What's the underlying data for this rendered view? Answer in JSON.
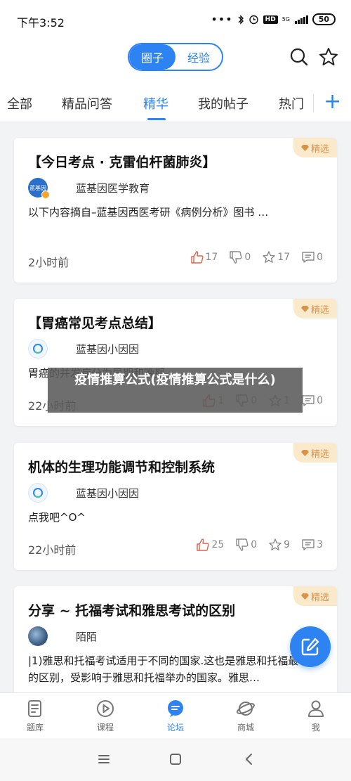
{
  "status_bar": {
    "time": "下午3:52",
    "dots": "•••",
    "hd": "HD",
    "net": "5G",
    "battery": "50"
  },
  "header": {
    "segments": [
      "圈子",
      "经验"
    ],
    "active_segment": 0
  },
  "tabs": {
    "items": [
      "全部",
      "精品问答",
      "精华",
      "我的帖子",
      "热门"
    ],
    "active": 2
  },
  "posts": [
    {
      "badge": "精选",
      "title": "【今日考点 · 克雷伯杆菌肺炎】",
      "author": "蓝基因医学教育",
      "avatar_text": "蓝基因",
      "excerpt": "以下内容摘自–蓝基因西医考研《病例分析》图书 …",
      "time": "2小时前",
      "likes": "17",
      "dislikes": "0",
      "stars": "17",
      "comments": "0"
    },
    {
      "badge": "精选",
      "title": "【胃癌常见考点总结】",
      "author": "蓝基因小因因",
      "excerpt": "胃癌的并发症分为早期和晚期…",
      "time": "22小时前",
      "likes": "1",
      "dislikes": "0",
      "stars": "1",
      "comments": "0"
    },
    {
      "badge": "精选",
      "title": "机体的生理功能调节和控制系统",
      "author": "蓝基因小因因",
      "excerpt": "点我吧^O^",
      "time": "22小时前",
      "likes": "25",
      "dislikes": "0",
      "stars": "9",
      "comments": "3"
    },
    {
      "badge": "精选",
      "title": "分享 ~ 托福考试和雅思考试的区别",
      "author": "陌陌",
      "excerpt": "|1)雅思和托福考试适用于不同的国家.这也是雅思和托福最本质的区别，受影响于雅思和托福举办的国家。雅思…"
    }
  ],
  "overlay": {
    "text": "疫情推算公式(疫情推算公式是什么)"
  },
  "bottom_nav": {
    "items": [
      "题库",
      "课程",
      "论坛",
      "商城",
      "我"
    ],
    "active": 2
  },
  "colors": {
    "accent": "#2e83f2",
    "badge_bg": "#fbe9cc",
    "badge_text": "#d9924a"
  }
}
